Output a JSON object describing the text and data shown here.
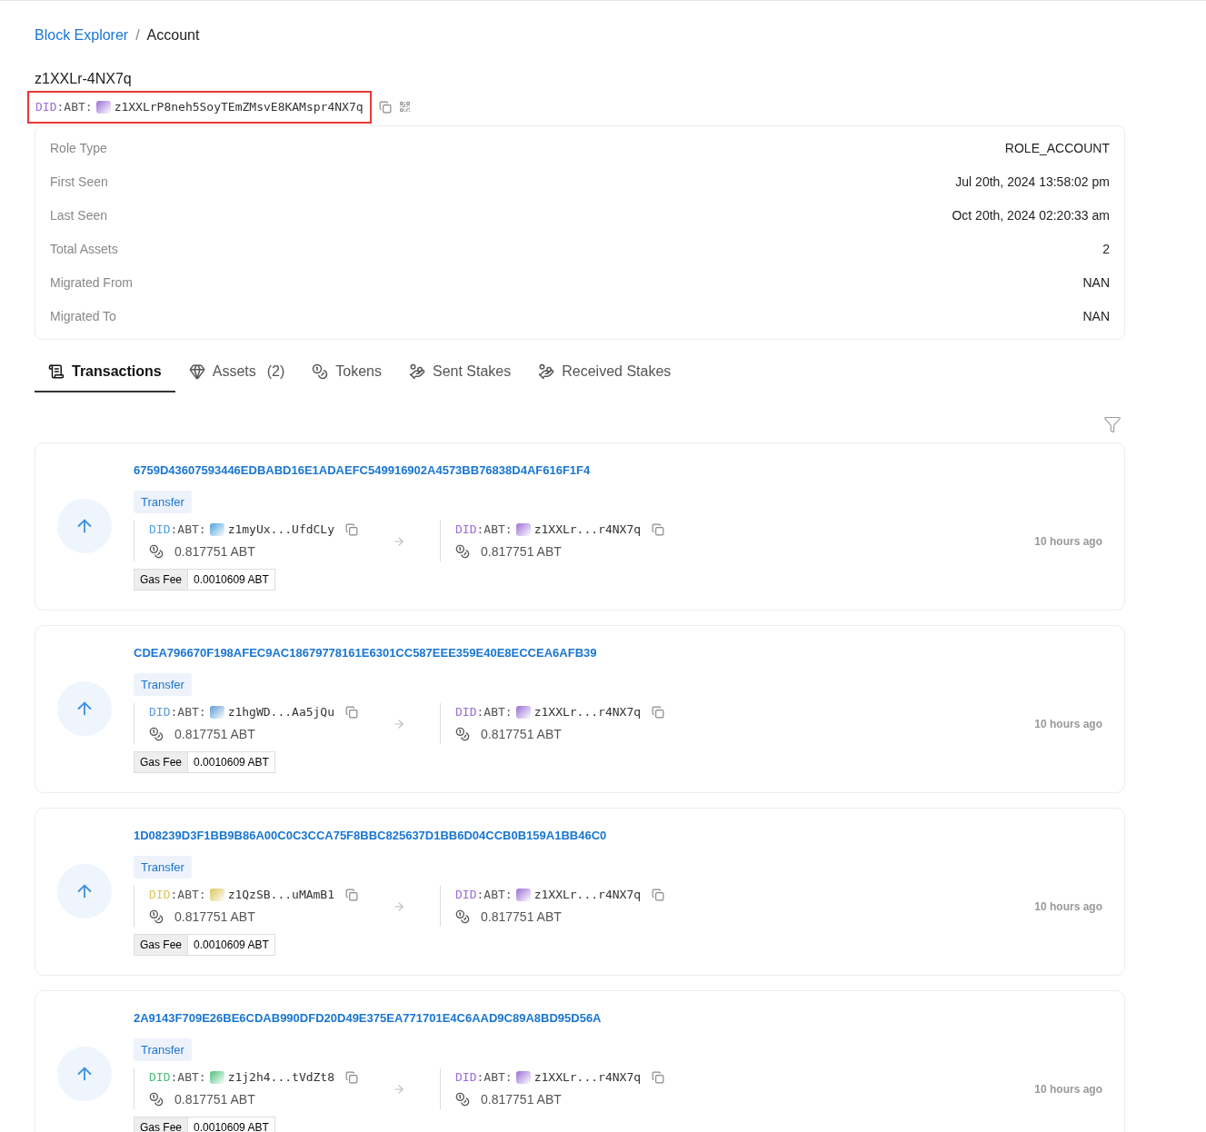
{
  "breadcrumb": [
    {
      "label": "Block Explorer",
      "kind": "link"
    },
    {
      "label": "Account",
      "kind": "current"
    }
  ],
  "breadcrumb_separator": "/",
  "account": {
    "name": "z1XXLr-4NX7q",
    "did_prefix": "DID",
    "did_rest": ":ABT:",
    "address": "z1XXLrP8neh5SoyTEmZMsvE8KAMspr4NX7q",
    "color": "#9b6dd6",
    "highlighted": true
  },
  "details": [
    {
      "label": "Role Type",
      "value": "ROLE_ACCOUNT"
    },
    {
      "label": "First Seen",
      "value": "Jul 20th, 2024 13:58:02 pm"
    },
    {
      "label": "Last Seen",
      "value": "Oct 20th, 2024 02:20:33 am"
    },
    {
      "label": "Total Assets",
      "value": "2"
    },
    {
      "label": "Migrated From",
      "value": "NAN"
    },
    {
      "label": "Migrated To",
      "value": "NAN"
    }
  ],
  "tabs": [
    {
      "label": "Transactions",
      "selected": true
    },
    {
      "label": "Assets",
      "count": "(2)",
      "selected": false
    },
    {
      "label": "Tokens",
      "selected": false
    },
    {
      "label": "Sent Stakes",
      "selected": false
    },
    {
      "label": "Received Stakes",
      "selected": false
    }
  ],
  "transactions": [
    {
      "hash": "6759D43607593446EDBABD16E1ADAEFC549916902A4573BB76838D4AF616F1F4",
      "type": "Transfer",
      "from": {
        "did_prefix": "DID",
        "did_rest": ":ABT:",
        "address": "z1myUx...UfdCLy",
        "color": "#4aa3df",
        "amount": "0.817751 ABT"
      },
      "to": {
        "did_prefix": "DID",
        "did_rest": ":ABT:",
        "address": "z1XXLr...r4NX7q",
        "color": "#9b6dd6",
        "amount": "0.817751 ABT"
      },
      "fee_label": "Gas Fee",
      "fee": "0.0010609 ABT",
      "time": "10 hours ago"
    },
    {
      "hash": "CDEA796670F198AFEC9AC18679778161E6301CC587EEE359E40E8ECCEA6AFB39",
      "type": "Transfer",
      "from": {
        "did_prefix": "DID",
        "did_rest": ":ABT:",
        "address": "z1hgWD...Aa5jQu",
        "color": "#5b9bd5",
        "amount": "0.817751 ABT"
      },
      "to": {
        "did_prefix": "DID",
        "did_rest": ":ABT:",
        "address": "z1XXLr...r4NX7q",
        "color": "#9b6dd6",
        "amount": "0.817751 ABT"
      },
      "fee_label": "Gas Fee",
      "fee": "0.0010609 ABT",
      "time": "10 hours ago"
    },
    {
      "hash": "1D08239D3F1BB9B86A00C0C3CCA75F8BBC825637D1BB6D04CCB0B159A1BB46C0",
      "type": "Transfer",
      "from": {
        "did_prefix": "DID",
        "did_rest": ":ABT:",
        "address": "z1QzSB...uMAmB1",
        "color": "#d9c55a",
        "amount": "0.817751 ABT"
      },
      "to": {
        "did_prefix": "DID",
        "did_rest": ":ABT:",
        "address": "z1XXLr...r4NX7q",
        "color": "#9b6dd6",
        "amount": "0.817751 ABT"
      },
      "fee_label": "Gas Fee",
      "fee": "0.0010609 ABT",
      "time": "10 hours ago"
    },
    {
      "hash": "2A9143F709E26BE6CDAB990DFD20D49E375EA771701E4C6AAD9C89A8BD95D56A",
      "type": "Transfer",
      "from": {
        "did_prefix": "DID",
        "did_rest": ":ABT:",
        "address": "z1j2h4...tVdZt8",
        "color": "#4cc17a",
        "amount": "0.817751 ABT"
      },
      "to": {
        "did_prefix": "DID",
        "did_rest": ":ABT:",
        "address": "z1XXLr...r4NX7q",
        "color": "#9b6dd6",
        "amount": "0.817751 ABT"
      },
      "fee_label": "Gas Fee",
      "fee": "0.0010609 ABT",
      "time": "10 hours ago"
    }
  ]
}
